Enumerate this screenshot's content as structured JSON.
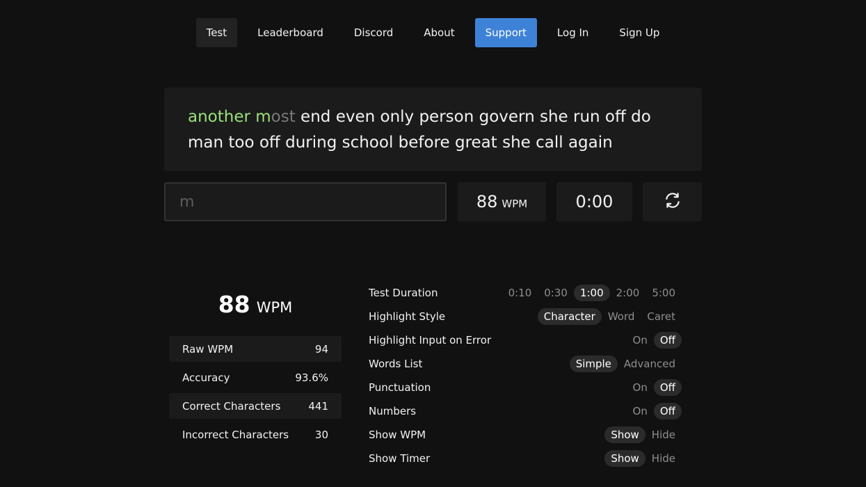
{
  "nav": {
    "items": [
      {
        "label": "Test",
        "state": "active"
      },
      {
        "label": "Leaderboard",
        "state": ""
      },
      {
        "label": "Discord",
        "state": ""
      },
      {
        "label": "About",
        "state": ""
      },
      {
        "label": "Support",
        "state": "primary"
      },
      {
        "label": "Log In",
        "state": ""
      },
      {
        "label": "Sign Up",
        "state": ""
      }
    ]
  },
  "words": {
    "typed_correct": "another m",
    "current_rest": "ost",
    "remaining": " end even only person govern she run off do man too off during school before great she call again"
  },
  "input": {
    "value": "m"
  },
  "live": {
    "wpm": "88",
    "wpm_unit": "WPM",
    "timer": "0:00",
    "reset_icon": "refresh-icon"
  },
  "results": {
    "wpm": "88",
    "wpm_unit": "WPM",
    "stats": [
      {
        "label": "Raw WPM",
        "value": "94"
      },
      {
        "label": "Accuracy",
        "value": "93.6%"
      },
      {
        "label": "Correct Characters",
        "value": "441"
      },
      {
        "label": "Incorrect Characters",
        "value": "30"
      }
    ]
  },
  "settings": [
    {
      "label": "Test Duration",
      "options": [
        "0:10",
        "0:30",
        "1:00",
        "2:00",
        "5:00"
      ],
      "selected": "1:00"
    },
    {
      "label": "Highlight Style",
      "options": [
        "Character",
        "Word",
        "Caret"
      ],
      "selected": "Character"
    },
    {
      "label": "Highlight Input on Error",
      "options": [
        "On",
        "Off"
      ],
      "selected": "Off"
    },
    {
      "label": "Words List",
      "options": [
        "Simple",
        "Advanced"
      ],
      "selected": "Simple"
    },
    {
      "label": "Punctuation",
      "options": [
        "On",
        "Off"
      ],
      "selected": "Off"
    },
    {
      "label": "Numbers",
      "options": [
        "On",
        "Off"
      ],
      "selected": "Off"
    },
    {
      "label": "Show WPM",
      "options": [
        "Show",
        "Hide"
      ],
      "selected": "Show"
    },
    {
      "label": "Show Timer",
      "options": [
        "Show",
        "Hide"
      ],
      "selected": "Show"
    }
  ],
  "colors": {
    "accent": "#3d82d6",
    "correct": "#9be07a",
    "pending": "#7a7a7a",
    "background": "#111111",
    "panel": "#1b1b1b"
  }
}
